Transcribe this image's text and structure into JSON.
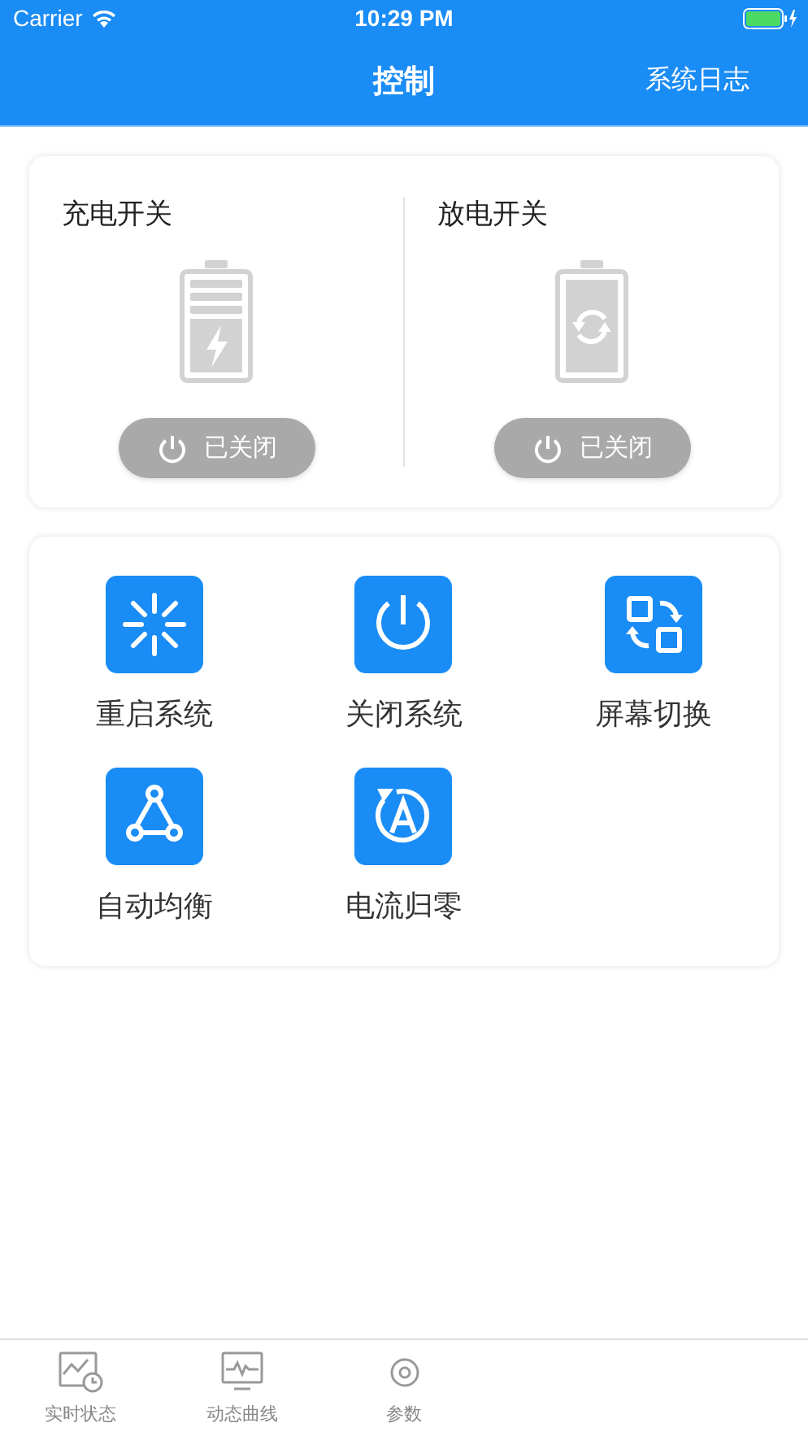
{
  "status_bar": {
    "carrier": "Carrier",
    "time": "10:29 PM"
  },
  "nav": {
    "title": "控制",
    "action": "系统日志"
  },
  "switches": [
    {
      "kind": "charge",
      "label": "充电开关",
      "on": false,
      "state_text": "已关闭"
    },
    {
      "kind": "discharge",
      "label": "放电开关",
      "on": false,
      "state_text": "已关闭"
    }
  ],
  "actions": [
    {
      "kind": "restart",
      "label": "重启系统"
    },
    {
      "kind": "shutdown",
      "label": "关闭系统"
    },
    {
      "kind": "screen",
      "label": "屏幕切换"
    },
    {
      "kind": "balance",
      "label": "自动均衡"
    },
    {
      "kind": "zero",
      "label": "电流归零"
    }
  ],
  "tabs": [
    {
      "kind": "realtime",
      "label": "实时状态",
      "selected": false
    },
    {
      "kind": "curve",
      "label": "动态曲线",
      "selected": false
    },
    {
      "kind": "params",
      "label": "参数",
      "selected": false
    }
  ]
}
